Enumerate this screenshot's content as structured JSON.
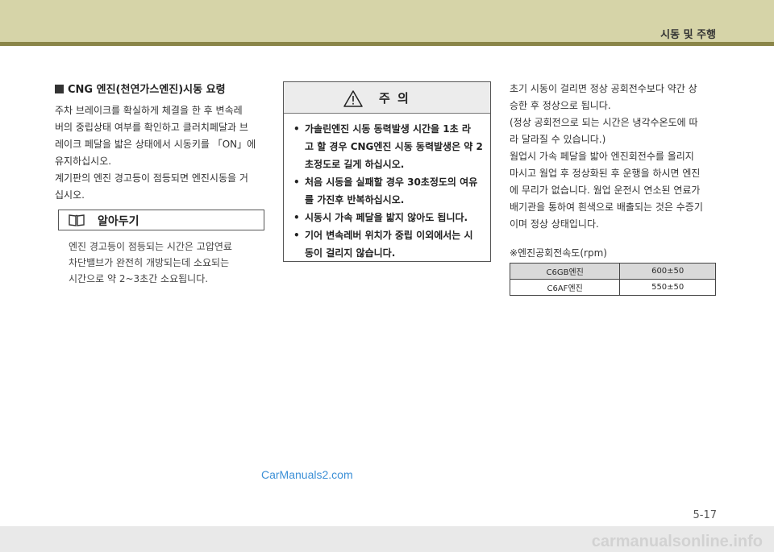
{
  "header": {
    "title": "시동 및 주행"
  },
  "section": {
    "title": "CNG 엔진(천연가스엔진)시동 요령",
    "lines": [
      "주차 브레이크를 확실하게 체결을 한 후 변속레",
      "버의 중립상태 여부를 확인하고 클러치페달과 브",
      "레이크 페달을 밟은 상태에서 시동키를 「ON」에",
      "유지하십시오.",
      "계기판의 엔진 경고등이 점등되면 엔진시동을 거",
      "십시오."
    ]
  },
  "note": {
    "title": "알아두기",
    "lines": [
      "엔진 경고등이 점등되는 시간은 고압연료",
      "차단밸브가 완전히 개방되는데 소요되는",
      "시간으로 약 2~3초간 소요됩니다."
    ]
  },
  "caution": {
    "title": "주 의",
    "items": [
      {
        "lines": [
          "가솔린엔진 시동 동력발생 시간을 1초 라",
          "고 할 경우 CNG엔진 시동 동력발생은 약 2",
          "초정도로 길게 하십시오."
        ]
      },
      {
        "lines": [
          "처음 시동을 실패할 경우 30초정도의 여유",
          "를 가진후 반복하십시오."
        ]
      },
      {
        "lines": [
          "시동시 가속 페달을 밟지 않아도 됩니다."
        ]
      },
      {
        "lines": [
          "기어 변속레버 위치가 중립 이외에서는 시",
          "동이 걸리지 않습니다."
        ]
      }
    ]
  },
  "right_text": {
    "lines": [
      "초기 시동이 걸리면 정상 공회전수보다 약간 상",
      "승한 후 정상으로 됩니다.",
      "(정상 공회전으로 되는 시간은 냉각수온도에 따",
      "라 달라질 수 있습니다.)",
      "웜업시 가속 페달을 밟아 엔진회전수를 올리지",
      "마시고 웜업 후 정상화된 후 운행을 하시면 엔진",
      "에 무리가 없습니다. 웜업 운전시 연소된 연료가",
      "배기관을 통하여 흰색으로 배출되는 것은 수증기",
      "이며 정상 상태입니다."
    ]
  },
  "rpm": {
    "title": "※엔진공회전속도(rpm)",
    "rows": [
      {
        "engine": "C6GB엔진",
        "value": "600±50"
      },
      {
        "engine": "C6AF엔진",
        "value": "550±50"
      }
    ]
  },
  "watermark": "CarManuals2.com",
  "page_number": "5-17",
  "footer": "carmanualsonline.info"
}
